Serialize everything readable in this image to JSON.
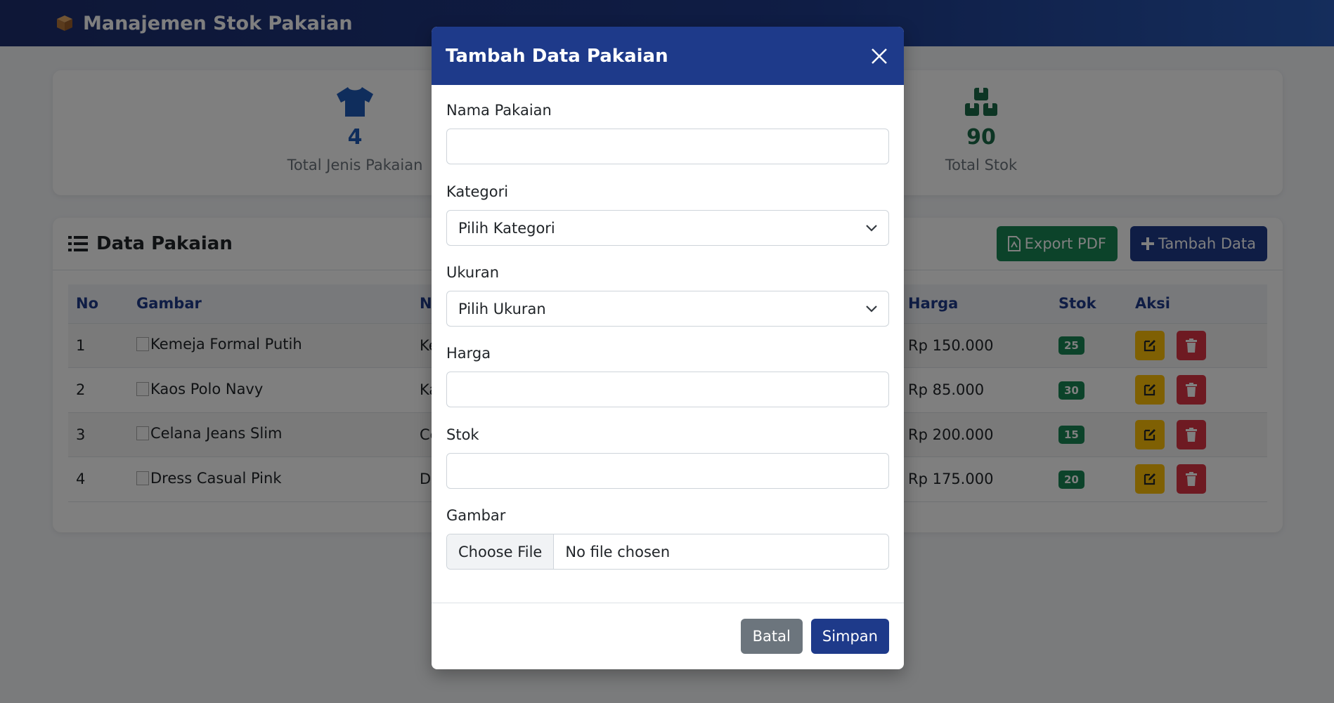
{
  "app": {
    "title": "Manajemen Stok Pakaian"
  },
  "stats": [
    {
      "value": "4",
      "label": "Total Jenis Pakaian",
      "color": "#1e5bb8"
    },
    {
      "value": "90",
      "label": "Total Stok",
      "color": "#1a6b48"
    }
  ],
  "table_card": {
    "title": "Data Pakaian",
    "export_label": "Export PDF",
    "add_label": "Tambah Data"
  },
  "table": {
    "columns": [
      "No",
      "Gambar",
      "N",
      "Harga",
      "Stok",
      "Aksi"
    ],
    "rows": [
      {
        "no": "1",
        "gambar": "Kemeja Formal Putih",
        "nama": "Ke",
        "harga": "Rp 150.000",
        "stok": "25"
      },
      {
        "no": "2",
        "gambar": "Kaos Polo Navy",
        "nama": "Ka",
        "harga": "Rp 85.000",
        "stok": "30"
      },
      {
        "no": "3",
        "gambar": "Celana Jeans Slim",
        "nama": "Ce",
        "harga": "Rp 200.000",
        "stok": "15"
      },
      {
        "no": "4",
        "gambar": "Dress Casual Pink",
        "nama": "D",
        "harga": "Rp 175.000",
        "stok": "20"
      }
    ]
  },
  "modal": {
    "title": "Tambah Data Pakaian",
    "fields": {
      "nama_label": "Nama Pakaian",
      "kategori_label": "Kategori",
      "kategori_value": "Pilih Kategori",
      "ukuran_label": "Ukuran",
      "ukuran_value": "Pilih Ukuran",
      "harga_label": "Harga",
      "stok_label": "Stok",
      "gambar_label": "Gambar",
      "choose_file": "Choose File",
      "no_file": "No file chosen"
    },
    "cancel_label": "Batal",
    "save_label": "Simpan"
  }
}
